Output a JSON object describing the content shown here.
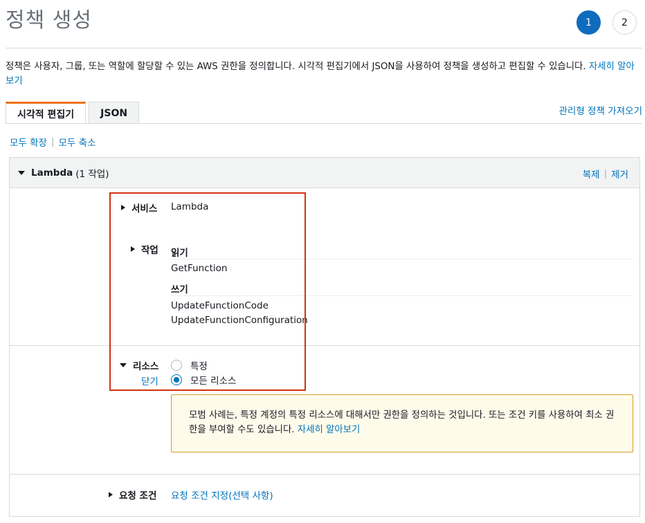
{
  "page": {
    "title": "정책 생성",
    "steps": [
      "1",
      "2"
    ]
  },
  "description": {
    "text": "정책은 사용자, 그룹, 또는 역할에 할당할 수 있는 AWS 권한을 정의합니다. 시각적 편집기에서 JSON을 사용하여 정책을 생성하고 편집할 수 있습니다.",
    "learn_more": "자세히 알아보기"
  },
  "tabs": [
    {
      "label": "시각적 편집기",
      "active": true
    },
    {
      "label": "JSON",
      "active": false
    }
  ],
  "import_managed": "관리형 정책 가져오기",
  "expand_all": "모두 확장",
  "collapse_all": "모두 축소",
  "separator": "|",
  "panel": {
    "title": "Lambda",
    "count": "(1 작업)",
    "duplicate": "복제",
    "remove": "제거",
    "service": {
      "label": "서비스",
      "value": "Lambda"
    },
    "actions": {
      "label": "작업",
      "groups": [
        {
          "title": "읽기",
          "items": [
            "GetFunction"
          ]
        },
        {
          "title": "쓰기",
          "items": [
            "UpdateFunctionCode",
            "UpdateFunctionConfiguration"
          ]
        }
      ]
    },
    "resources": {
      "label": "리소스",
      "close": "닫기",
      "options": [
        {
          "label": "특정",
          "checked": false
        },
        {
          "label": "모든 리소스",
          "checked": true
        }
      ],
      "info": "모범 사례는, 특정 계정의 특정 리소스에 대해서만 권한을 정의하는 것입니다. 또는 조건 키를 사용하여 최소 권한을 부여할 수도 있습니다.",
      "info_link": "자세히 알아보기"
    },
    "conditions": {
      "label": "요청 조건",
      "link": "요청 조건 지정(선택 사항)"
    }
  },
  "colors": {
    "link": "#0073bb",
    "step_active": "#0f6cbd",
    "tab_accent": "#ec7211",
    "highlight_box": "#d13212",
    "info_bg": "#fffbeb",
    "info_border": "#d39d2a"
  }
}
